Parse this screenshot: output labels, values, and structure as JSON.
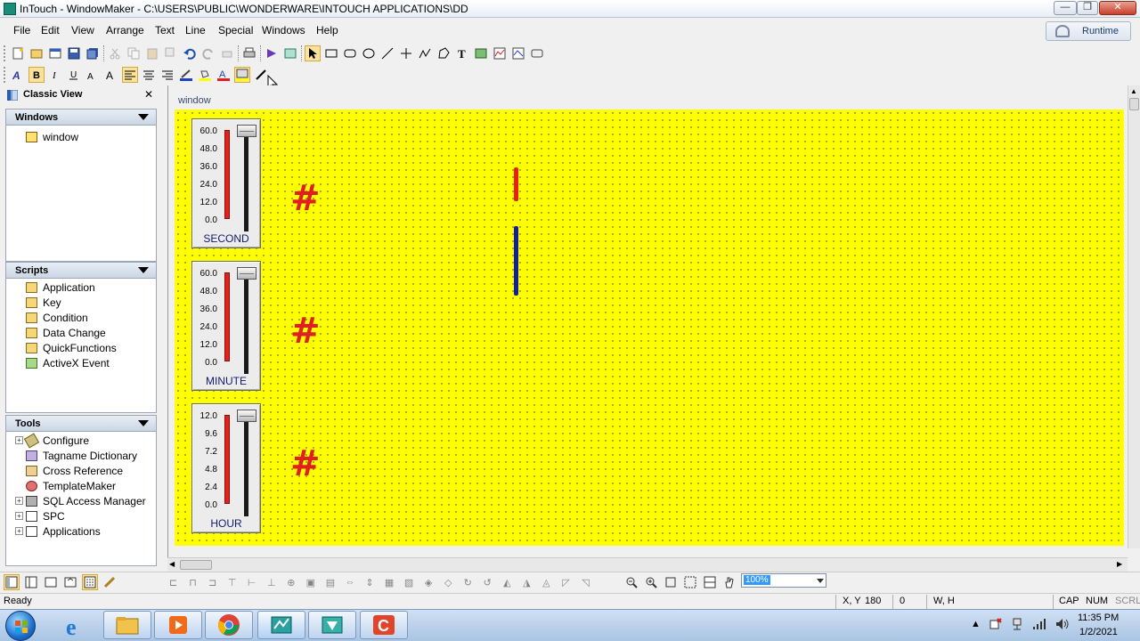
{
  "window": {
    "title": "InTouch - WindowMaker - C:\\USERS\\PUBLIC\\WONDERWARE\\INTOUCH APPLICATIONS\\DD",
    "min_glyph": "—",
    "max_glyph": "❐",
    "close_glyph": "✕"
  },
  "menu": {
    "items": [
      "File",
      "Edit",
      "View",
      "Arrange",
      "Text",
      "Line",
      "Special",
      "Windows",
      "Help"
    ],
    "runtime_label": "Runtime"
  },
  "classic_view": {
    "title": "Classic View",
    "close_glyph": "✕"
  },
  "windows_panel": {
    "title": "Windows",
    "items": [
      "window"
    ]
  },
  "scripts_panel": {
    "title": "Scripts",
    "items": [
      "Application",
      "Key",
      "Condition",
      "Data Change",
      "QuickFunctions",
      "ActiveX Event"
    ]
  },
  "tools_panel": {
    "title": "Tools",
    "items": [
      "Configure",
      "Tagname Dictionary",
      "Cross Reference",
      "TemplateMaker",
      "SQL Access Manager",
      "SPC",
      "Applications"
    ]
  },
  "canvas": {
    "caption": "window",
    "sliders": [
      {
        "label": "SECOND",
        "ticks": [
          "60.0",
          "48.0",
          "36.0",
          "24.0",
          "12.0",
          "0.0"
        ],
        "hash": "#"
      },
      {
        "label": "MINUTE",
        "ticks": [
          "60.0",
          "48.0",
          "36.0",
          "24.0",
          "12.0",
          "0.0"
        ],
        "hash": "#"
      },
      {
        "label": "HOUR",
        "ticks": [
          "12.0",
          "9.6",
          "7.2",
          "4.8",
          "2.4",
          "0.0"
        ],
        "hash": "#"
      }
    ],
    "colors": {
      "background": "#ffff00",
      "hand_red": "#e82010",
      "hand_blue": "#1020a0"
    }
  },
  "zoom": {
    "value": "100%"
  },
  "status": {
    "ready": "Ready",
    "xy_label": "X, Y",
    "x": "180",
    "y": "0",
    "wh_label": "W, H",
    "cap": "CAP",
    "num": "NUM",
    "scrl": "SCRL"
  },
  "tray": {
    "time": "11:35 PM",
    "date": "1/2/2021"
  }
}
